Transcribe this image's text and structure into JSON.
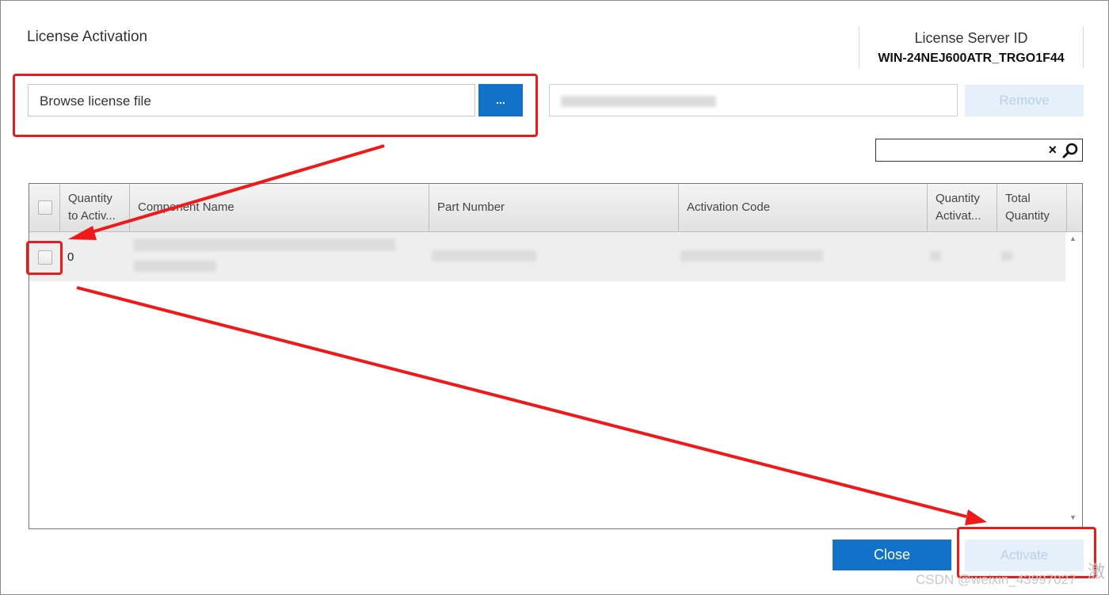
{
  "dialog": {
    "title": "License Activation",
    "server": {
      "label": "License Server ID",
      "id": "WIN-24NEJ600ATR_TRGO1F44"
    }
  },
  "browse": {
    "placeholder": "Browse license file",
    "button_label": "..."
  },
  "buttons": {
    "remove": "Remove",
    "close": "Close",
    "activate": "Activate"
  },
  "search": {
    "clear_icon": "×",
    "icon": "search-icon"
  },
  "table": {
    "headers": [
      "Quantity to Activ...",
      "Component Name",
      "Part Number",
      "Activation Code",
      "Quantity Activat...",
      "Total Quantity"
    ],
    "rows": [
      {
        "quantity_to_activate": "0"
      }
    ]
  },
  "watermark": {
    "text": "CSDN @weixin_43997027",
    "cjk": "激"
  },
  "colors": {
    "primary_button": "#1272c9",
    "disabled_button": "#e6f0fa",
    "annotation_red": "#f01919"
  }
}
